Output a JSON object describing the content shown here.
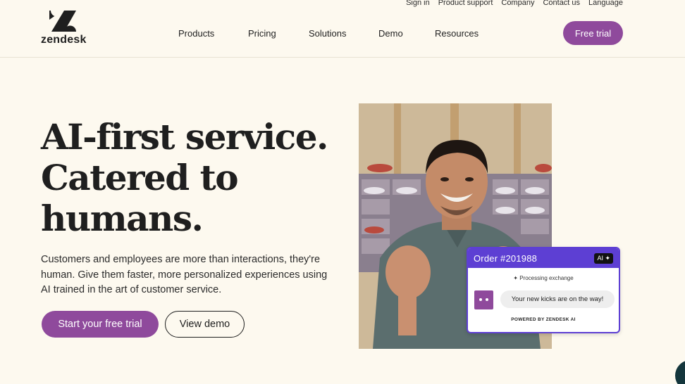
{
  "utility_nav": [
    "Sign in",
    "Product support",
    "Company",
    "Contact us",
    "Language"
  ],
  "logo": {
    "text": "zendesk"
  },
  "main_nav": [
    "Products",
    "Pricing",
    "Solutions",
    "Demo",
    "Resources"
  ],
  "header_cta": "Free trial",
  "hero": {
    "title_lines": [
      "AI-first service.",
      "Catered to",
      "humans."
    ],
    "description": "Customers and employees are more than interactions, they're human. Give them faster, more personalized experiences using AI trained in the art of customer service.",
    "primary_cta": "Start your free trial",
    "secondary_cta": "View demo"
  },
  "order_card": {
    "title": "Order #201988",
    "ai_badge": "AI ✦",
    "status": "✦ Processing exchange",
    "message": "Your new kicks are on the way!",
    "powered_by": "POWERED BY ZENDESK AI"
  },
  "colors": {
    "background": "#fdf9ef",
    "brand_purple": "#8f4a9c",
    "card_accent": "#5d3fd3",
    "text": "#1f1f1f"
  }
}
